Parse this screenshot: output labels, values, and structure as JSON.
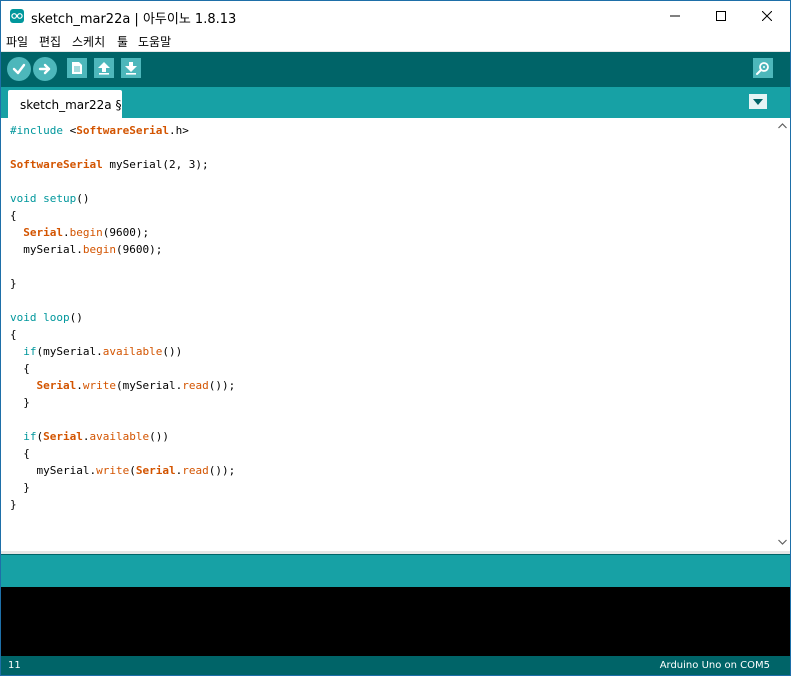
{
  "window": {
    "title": "sketch_mar22a | 아두이노 1.8.13"
  },
  "menu": {
    "items": [
      "파일",
      "편집",
      "스케치",
      "툴",
      "도움말"
    ]
  },
  "toolbar": {
    "buttons": [
      "verify-icon",
      "upload-icon",
      "new-icon",
      "open-icon",
      "save-icon"
    ],
    "right_button": "serial-monitor-icon"
  },
  "tab": {
    "label": "sketch_mar22a §"
  },
  "editor": {
    "lines": [
      "#include <SoftwareSerial.h>",
      "",
      "SoftwareSerial mySerial(2, 3);",
      "",
      "void setup()",
      "{",
      "  Serial.begin(9600);",
      "  mySerial.begin(9600);",
      "",
      "}",
      "",
      "void loop()",
      "{",
      "  if(mySerial.available())",
      "  {",
      "    Serial.write(mySerial.read());",
      "  }",
      "",
      "  if(Serial.available())",
      "  {",
      "    mySerial.write(Serial.read());",
      "  }",
      "}"
    ]
  },
  "status": {
    "line": "11",
    "board": "Arduino Uno on COM5"
  },
  "colors": {
    "toolbar": "#006468",
    "accent": "#17a1a5",
    "button": "#4db7bb",
    "keyword": "#00979c",
    "function": "#d35400"
  }
}
